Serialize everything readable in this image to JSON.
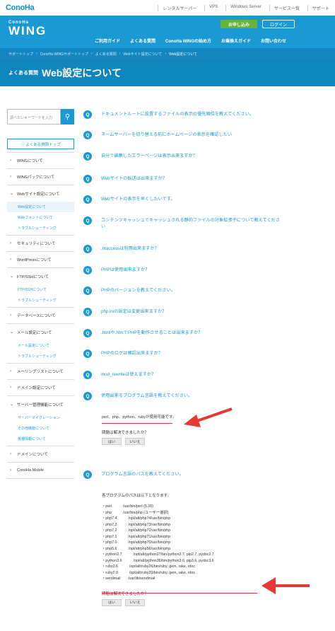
{
  "header": {
    "brand": "ConoHa",
    "topnav": [
      "レンタルサーバー",
      "VPS",
      "Windows Server",
      "サービス一覧",
      "サポート"
    ],
    "wing_sub": "ConoHa",
    "wing_main": "WING",
    "apply_label": "お申し込み",
    "login_label": "ログイン",
    "mainnav": [
      "ご利用ガイド",
      "よくある質問",
      "ConoHa WINGの始め方",
      "お乗換えガイド",
      "お問い合わせ"
    ]
  },
  "breadcrumb": [
    "サポートトップ",
    "ConoHa WINGサポートトップ",
    "よくある質問",
    "Webサイト設定について",
    "Web設定について"
  ],
  "page": {
    "small_title": "よくある質問",
    "title": "Web設定について"
  },
  "sidebar": {
    "search_placeholder": "調べたいキーワードを入力",
    "faq_top": "よくある質問トップ",
    "items": [
      {
        "label": "WINGについて"
      },
      {
        "label": "WINGパックについて"
      },
      {
        "label": "Webサイト設定について",
        "subs": [
          "Web設定について",
          "Webフォントについて",
          "トラブルシューティング"
        ]
      },
      {
        "label": "セキュリティについて"
      },
      {
        "label": "WordPressについて"
      },
      {
        "label": "FTP/SSHについて",
        "subs": [
          "FTP/SSHについて",
          "トラブルシューティング"
        ]
      },
      {
        "label": "データベースについて"
      },
      {
        "label": "メール設定について",
        "subs": [
          "メール設定について",
          "トラブルシューティング"
        ]
      },
      {
        "label": "メーリングリストについて"
      },
      {
        "label": "ドメイン設定について"
      },
      {
        "label": "サーバー管理機能について",
        "subs": [
          "サーバーマイグレーション",
          "その他機能について",
          "各種情報について"
        ]
      },
      {
        "label": "ドメインについて"
      },
      {
        "label": "ConoHa Mobile"
      }
    ]
  },
  "questions": [
    "ドキュメントルートに設置するファイルの表示の優先順位を教えてください。",
    "ネームサーバーを切り替える前にホームページの表示を確認したい",
    "自分で編集したエラーページは表示出来ますか？",
    "Webサイトの転送は出来ますか？",
    "Webサイトの表示を早くしたいです。",
    "コンテンツキャッシュでキャッシュされる静的ファイルの対象拡張子について教えてください",
    ".htaccessは利用出来ますか？",
    "PHPは使用出来ますか？",
    "PHPのバージョンを教えてください。",
    "php.iniの設定は変更出来ますか？",
    ".htmlや.htmでPHPを動作させることは出来ますか？",
    "PHPのログは確認出来ますか？",
    "mod_rewriteは使えますか？",
    "使用出来るプログラム言語を教えてください。",
    "プログラム言語のパスを教えてください。"
  ],
  "answer1": {
    "text": "perl、php、python、rubyが使用可能です。",
    "question": "問題は解決できましたか？",
    "yes": "はい",
    "no": "いいえ"
  },
  "answer2": {
    "intro": "各プログラムのパスは以下となります。",
    "paths": [
      "・perl　　　/usr/bin/perl (5.16)",
      "・php　　　/usr/bin/php (ユーザー選択)",
      "・php7.4　　　/opt/alt/php74/usr/bin/php",
      "・php7.3　　　/opt/alt/php73/usr/bin/php",
      "・php7.2　　　/opt/alt/php72/usr/bin/php",
      "・php7.1　　　/opt/alt/php71/usr/bin/php",
      "・php7.0　　　/opt/alt/php70/usr/bin/php",
      "・php5.6　　　/opt/alt/php56/usr/bin/php",
      "・python2.7　　　/opt/alt/python27/bin/python2.7, pip2.7, pydoc2.7",
      "・python3.6　　　/opt/alt/python36/bin/python3.6, pip3.6, pydoc3.6",
      "・ruby2.6　　　/opt/alt/ruby26/bin/ruby, gem, rake, rdoc",
      "・ruby2.0　　　/opt/alt/ruby20/bin/ruby, gem, rake, rdoc",
      "・sendmail　　/usr/lib/sendmail"
    ],
    "question": "問題は解決できましたか？",
    "yes": "はい",
    "no": "いいえ"
  },
  "colors": {
    "primary": "#1a99d3",
    "green": "#6ab23a",
    "annotation": "#e53935"
  }
}
